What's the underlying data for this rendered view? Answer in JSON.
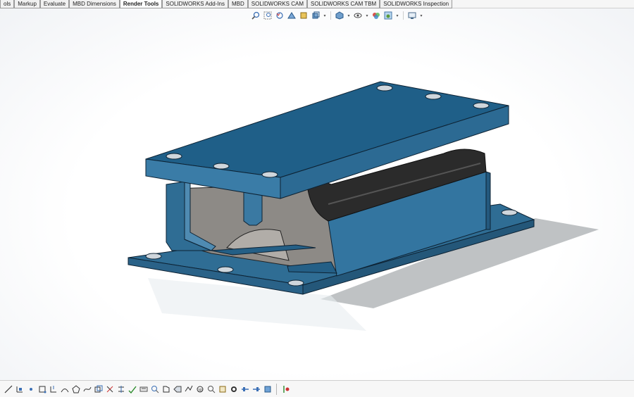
{
  "app": "SOLIDWORKS",
  "tabs": [
    {
      "label": "ols",
      "active": false
    },
    {
      "label": "Markup",
      "active": false
    },
    {
      "label": "Evaluate",
      "active": false
    },
    {
      "label": "MBD Dimensions",
      "active": false
    },
    {
      "label": "Render Tools",
      "active": true
    },
    {
      "label": "SOLIDWORKS Add-Ins",
      "active": false
    },
    {
      "label": "MBD",
      "active": false
    },
    {
      "label": "SOLIDWORKS CAM",
      "active": false
    },
    {
      "label": "SOLIDWORKS CAM TBM",
      "active": false
    },
    {
      "label": "SOLIDWORKS Inspection",
      "active": false
    }
  ],
  "heads_up_toolbar": [
    "zoom-to-fit-icon",
    "zoom-to-area-icon",
    "previous-view-icon",
    "section-view-icon",
    "dynamic-annotation-icon",
    "view-orientation-icon",
    "display-style-icon",
    "hide-show-items-icon",
    "edit-appearance-icon",
    "apply-scene-icon",
    "view-settings-icon"
  ],
  "bottom_toolbar": [
    "line-icon",
    "dimension-icon",
    "point-icon",
    "corner-rectangle-icon",
    "center-rectangle-icon",
    "tangent-arc-icon",
    "polygon-icon",
    "spline-icon",
    "offset-icon",
    "trim-icon",
    "relations-icon",
    "smart-dimension-icon",
    "zoom-icon",
    "pan-icon",
    "rotate-icon",
    "roll-icon",
    "normal-to-icon",
    "section-icon",
    "measure-icon",
    "mass-properties-icon",
    "interference-icon",
    "clearance-icon",
    "check-icon",
    "move-icon",
    "view-icon"
  ],
  "colors": {
    "part_blue": "#2f6c92",
    "part_blue_dark": "#1e4f70",
    "part_top": "#245f86",
    "cavity_grey": "#8d8a86",
    "rubber_black": "#2b2b2b",
    "accent": "#1f5c8a"
  }
}
